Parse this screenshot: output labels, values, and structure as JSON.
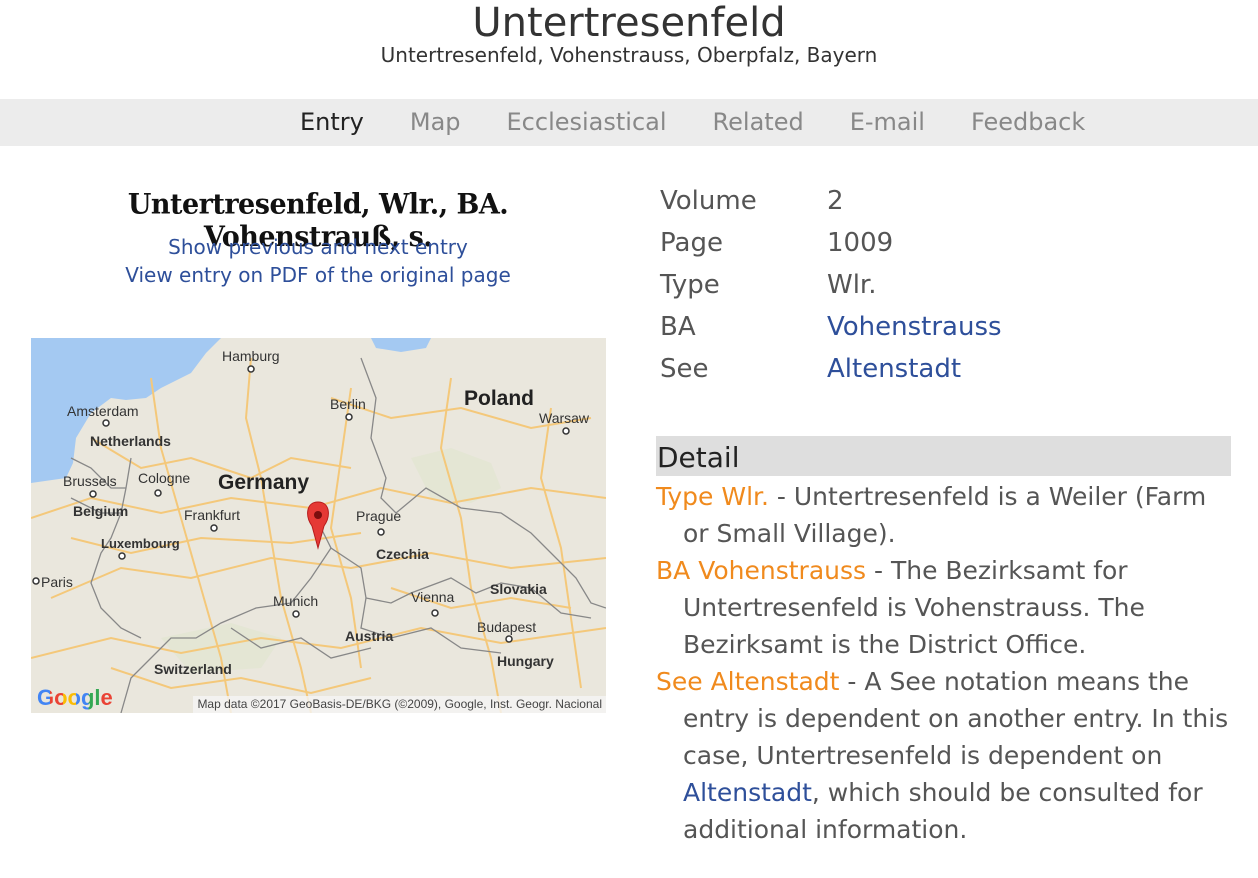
{
  "header": {
    "title": "Untertresenfeld",
    "subtitle": "Untertresenfeld, Vohenstrauss, Oberpfalz, Bayern"
  },
  "nav": {
    "tabs": [
      {
        "label": "Entry",
        "active": true
      },
      {
        "label": "Map",
        "active": false
      },
      {
        "label": "Ecclesiastical",
        "active": false
      },
      {
        "label": "Related",
        "active": false
      },
      {
        "label": "E-mail",
        "active": false
      },
      {
        "label": "Feedback",
        "active": false
      }
    ]
  },
  "entry": {
    "original_text": "Untertresenfeld, Wlr., BA. Vohenstrauß, s.",
    "show_prev_next": "Show previous and next entry",
    "view_pdf": "View entry on PDF of the original page"
  },
  "map": {
    "labels": {
      "hamburg": "Hamburg",
      "amsterdam": "Amsterdam",
      "netherlands": "Netherlands",
      "berlin": "Berlin",
      "poland": "Poland",
      "warsaw": "Warsaw",
      "brussels": "Brussels",
      "cologne": "Cologne",
      "germany": "Germany",
      "belgium": "Belgium",
      "frankfurt": "Frankfurt",
      "prague": "Prague",
      "luxembourg": "Luxembourg",
      "czechia": "Czechia",
      "paris": "Paris",
      "slovakia": "Slovakia",
      "vienna": "Vienna",
      "munich": "Munich",
      "budapest": "Budapest",
      "austria": "Austria",
      "switzerland": "Switzerland",
      "hungary": "Hungary"
    },
    "logo": "Google",
    "attribution": "Map data ©2017 GeoBasis-DE/BKG (©2009), Google, Inst. Geogr. Nacional",
    "colors": {
      "water": "#a4c9f2",
      "land": "#eae7dd",
      "road": "#f4c87a",
      "border": "#777777",
      "marker": "#e53935"
    }
  },
  "properties": {
    "volume": {
      "label": "Volume",
      "value": "2"
    },
    "page": {
      "label": "Page",
      "value": "1009"
    },
    "type": {
      "label": "Type",
      "value": "Wlr."
    },
    "ba": {
      "label": "BA",
      "value": "Vohenstrauss"
    },
    "see": {
      "label": "See",
      "value": "Altenstadt"
    }
  },
  "detail": {
    "heading": "Detail",
    "type": {
      "term": "Type Wlr.",
      "text": " - Untertresenfeld is a Weiler (Farm or Small Village)."
    },
    "ba": {
      "term": "BA Vohenstrauss",
      "text": " - The Bezirksamt for Untertresenfeld is Vohenstrauss. The Bezirksamt is the District Office."
    },
    "see": {
      "term": "See Altenstadt",
      "text_before": " - A See notation means the entry is dependent on another entry. In this case, Untertresenfeld is dependent on ",
      "link": "Altenstadt",
      "text_after": ", which should be consulted for additional information."
    }
  }
}
